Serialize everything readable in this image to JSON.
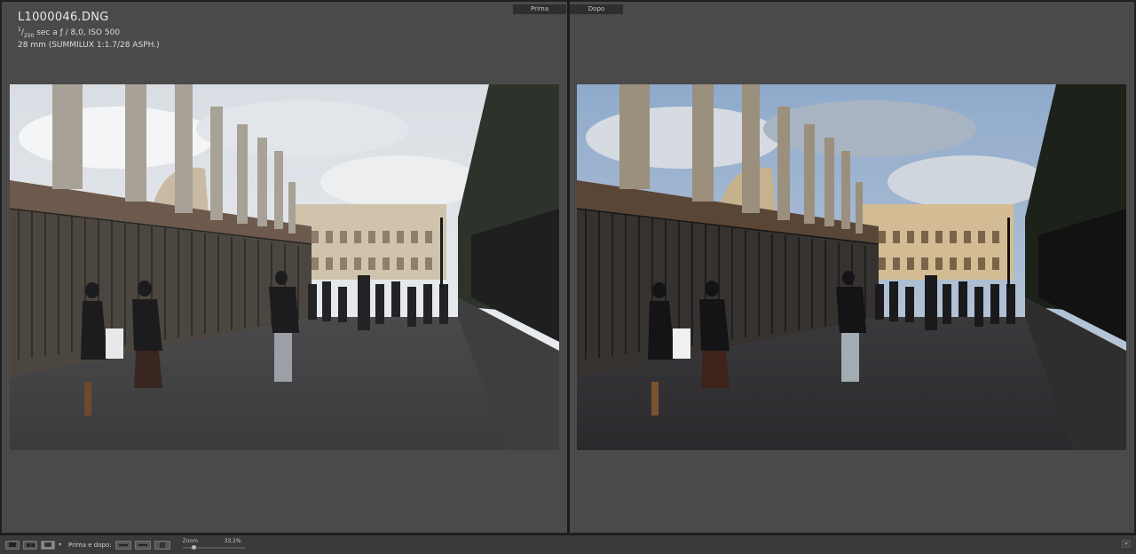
{
  "window": {
    "tabs": {
      "before": "Prima",
      "after": "Dopo"
    }
  },
  "photo": {
    "filename": "L1000046.DNG",
    "shutter_numerator": "1",
    "shutter_denominator": "250",
    "exposure_rest": " sec a ƒ / 8,0, ISO 500",
    "lens": "28 mm (SUMMILUX 1:1.7/28 ASPH.)"
  },
  "toolbar": {
    "mode_label": "Prima e dopo:",
    "zoom_label": "Zoom",
    "zoom_value": "33,1%",
    "zoom_level": 0.16
  },
  "colors": {
    "pane_bg": "#4a4a4a",
    "toolbar_bg": "#3a3a3a"
  }
}
